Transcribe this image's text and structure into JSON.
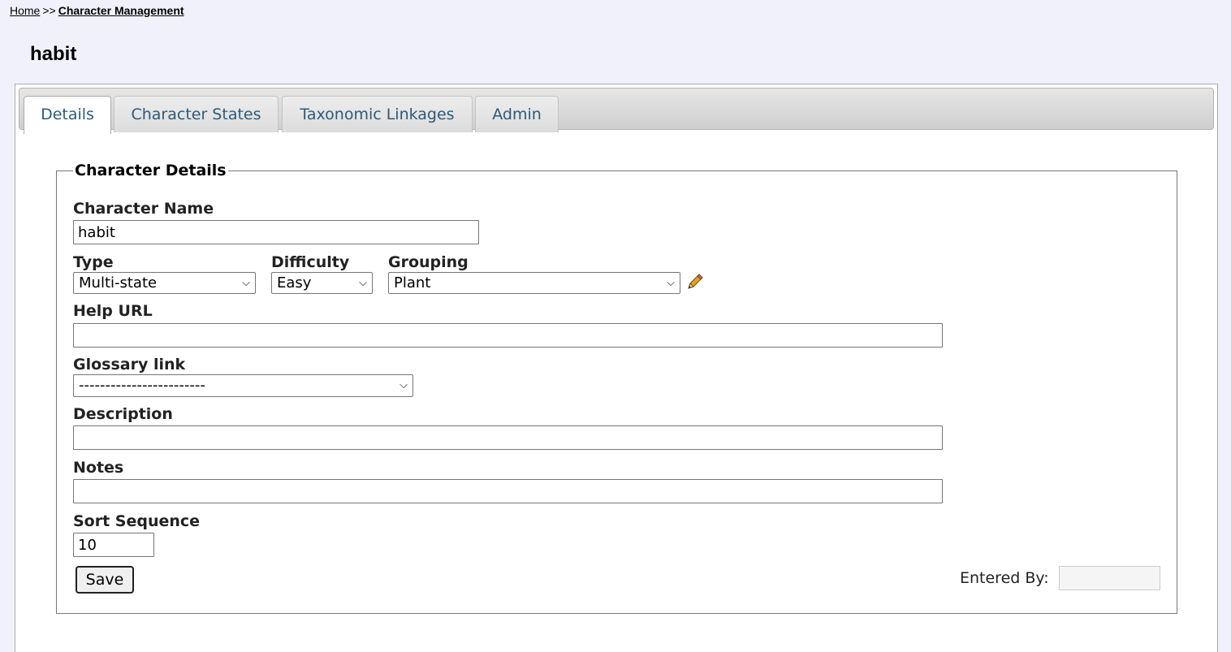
{
  "breadcrumb": {
    "home": "Home",
    "separator": ">>",
    "current": "Character Management"
  },
  "page_title": "habit",
  "tabs": [
    {
      "label": "Details",
      "active": true
    },
    {
      "label": "Character States",
      "active": false
    },
    {
      "label": "Taxonomic Linkages",
      "active": false
    },
    {
      "label": "Admin",
      "active": false
    }
  ],
  "form": {
    "legend": "Character Details",
    "character_name": {
      "label": "Character Name",
      "value": "habit"
    },
    "type": {
      "label": "Type",
      "value": "Multi-state"
    },
    "difficulty": {
      "label": "Difficulty",
      "value": "Easy"
    },
    "grouping": {
      "label": "Grouping",
      "value": "Plant",
      "edit_icon": "pencil-icon"
    },
    "help_url": {
      "label": "Help URL",
      "value": ""
    },
    "glossary_link": {
      "label": "Glossary link",
      "value": "------------------------"
    },
    "description": {
      "label": "Description",
      "value": ""
    },
    "notes": {
      "label": "Notes",
      "value": ""
    },
    "sort_sequence": {
      "label": "Sort Sequence",
      "value": "10"
    },
    "save_label": "Save",
    "entered_by": {
      "label": "Entered By:",
      "value": ""
    }
  }
}
